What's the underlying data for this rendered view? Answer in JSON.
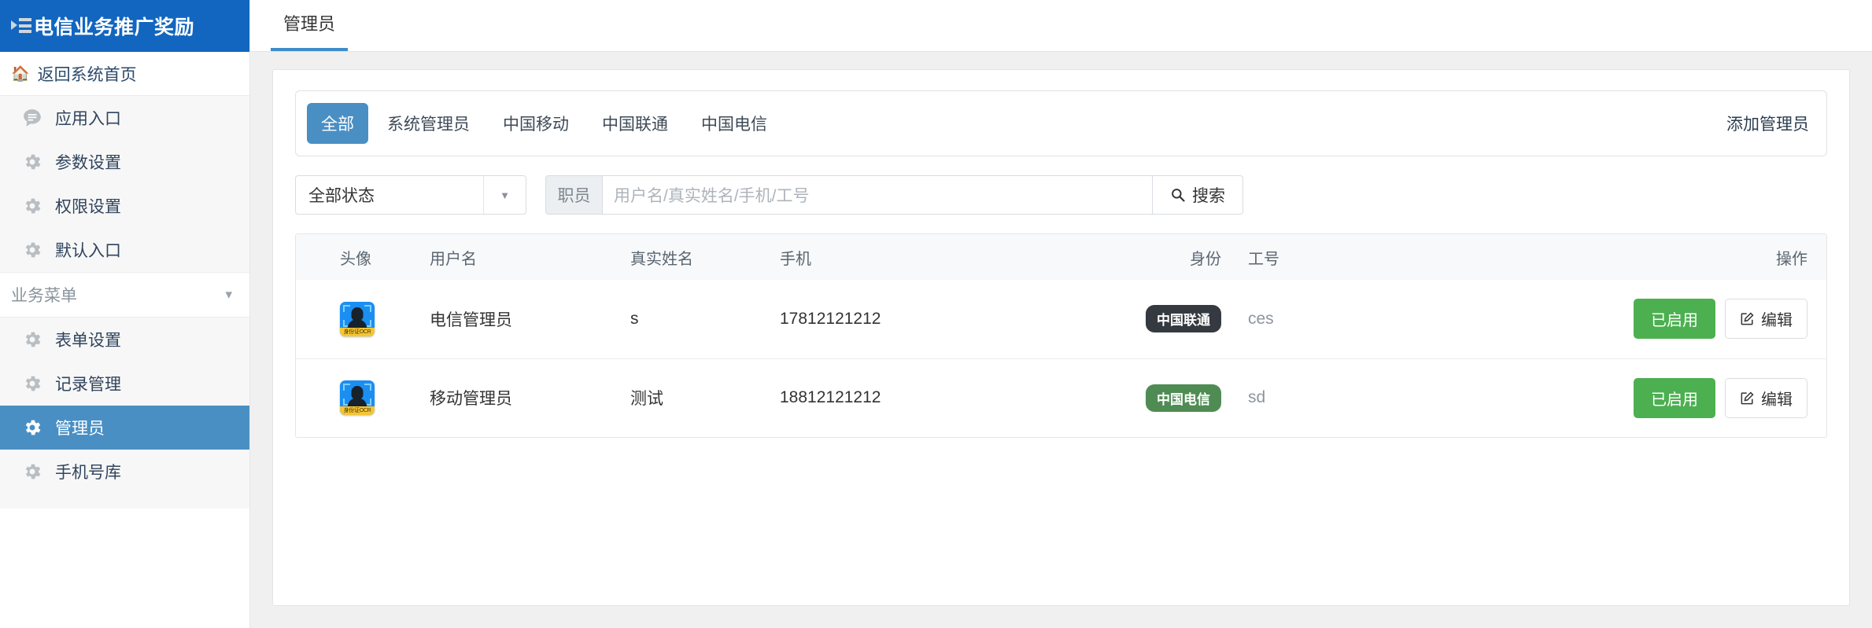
{
  "sidebar": {
    "brand": {
      "title": "电信业务推广奖励",
      "icon": "list-indent-icon"
    },
    "home": {
      "label": "返回系统首页",
      "icon": "home-icon"
    },
    "items": [
      {
        "label": "应用入口",
        "icon": "chat-bubble-icon",
        "active": false
      },
      {
        "label": "参数设置",
        "icon": "gear-icon",
        "active": false
      },
      {
        "label": "权限设置",
        "icon": "gear-icon",
        "active": false
      },
      {
        "label": "默认入口",
        "icon": "gear-icon",
        "active": false
      }
    ],
    "section": {
      "label": "业务菜单",
      "icon": "chevron-down-icon"
    },
    "section_items": [
      {
        "label": "表单设置",
        "icon": "gear-icon",
        "active": false
      },
      {
        "label": "记录管理",
        "icon": "gear-icon",
        "active": false
      },
      {
        "label": "管理员",
        "icon": "gear-icon",
        "active": true
      },
      {
        "label": "手机号库",
        "icon": "gear-icon",
        "active": false
      }
    ]
  },
  "tabs": [
    {
      "label": "管理员",
      "active": true
    }
  ],
  "filter": {
    "chips": [
      {
        "label": "全部",
        "active": true
      },
      {
        "label": "系统管理员",
        "active": false
      },
      {
        "label": "中国移动",
        "active": false
      },
      {
        "label": "中国联通",
        "active": false
      },
      {
        "label": "中国电信",
        "active": false
      }
    ],
    "add_label": "添加管理员"
  },
  "search": {
    "status_value": "全部状态",
    "addon_label": "职员",
    "placeholder": "用户名/真实姓名/手机/工号",
    "input_value": "",
    "button_label": "搜索",
    "button_icon": "search-icon"
  },
  "table": {
    "headers": [
      "头像",
      "用户名",
      "真实姓名",
      "手机",
      "身份",
      "工号",
      "操作"
    ],
    "rows": [
      {
        "avatar_alt": "身份证OCR",
        "username": "电信管理员",
        "realname": "s",
        "phone": "17812121212",
        "identity": "中国联通",
        "identity_color": "#343a40",
        "jobno": "ces",
        "status_label": "已启用",
        "edit_label": "编辑"
      },
      {
        "avatar_alt": "身份证OCR",
        "username": "移动管理员",
        "realname": "测试",
        "phone": "18812121212",
        "identity": "中国电信",
        "identity_color": "#4f8c53",
        "jobno": "sd",
        "status_label": "已启用",
        "edit_label": "编辑"
      }
    ]
  },
  "colors": {
    "brand_blue": "#1266bf",
    "accent_blue": "#4a8fc4",
    "tab_underline": "#3f8cc9",
    "success_green": "#4cb050",
    "badge_dark": "#343a40",
    "badge_green": "#4f8c53"
  }
}
